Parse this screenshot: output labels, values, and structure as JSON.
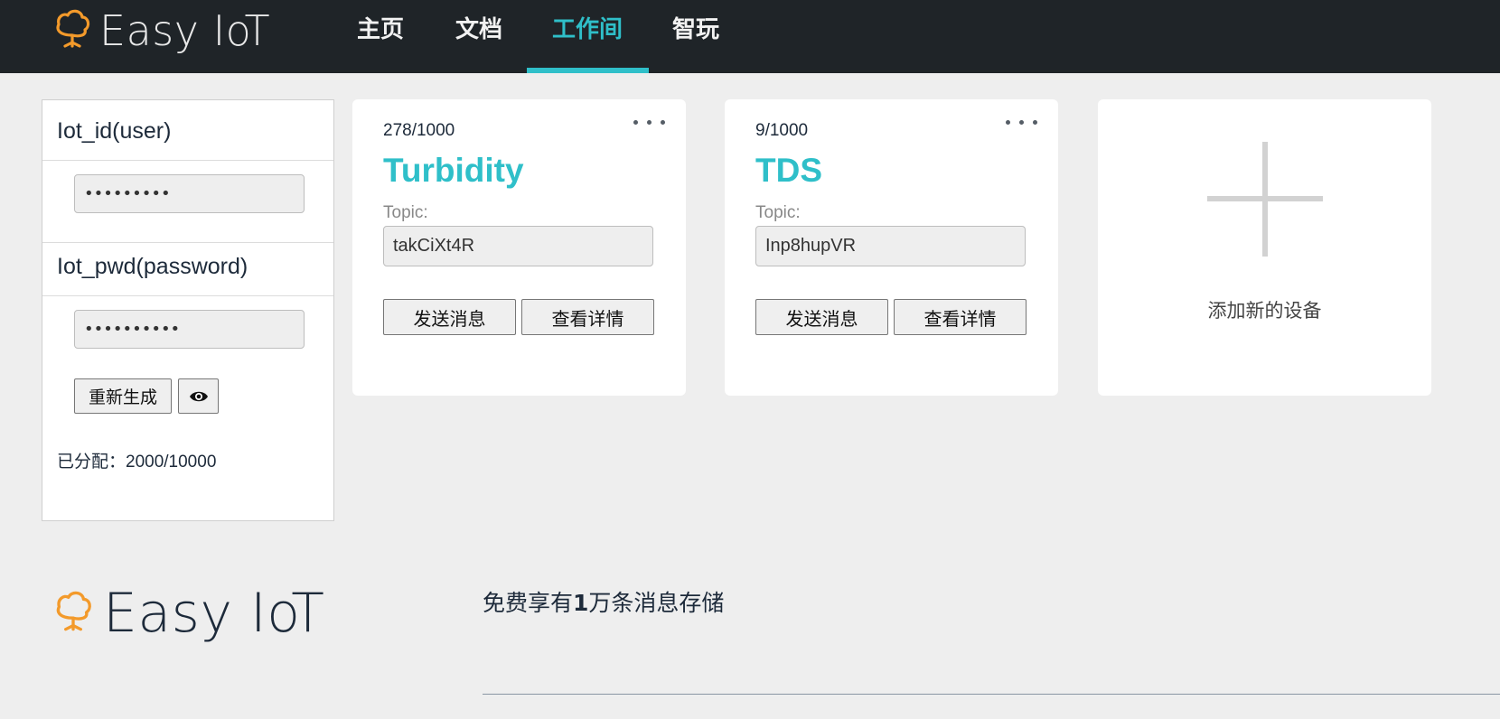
{
  "brand": {
    "name": "Easy IoT",
    "accent": "#f39a2b",
    "nav_bg": "#1f2428",
    "active_color": "#2fbfc9"
  },
  "nav": {
    "items": [
      {
        "label": "主页",
        "active": false
      },
      {
        "label": "文档",
        "active": false
      },
      {
        "label": "工作间",
        "active": true
      },
      {
        "label": "智玩",
        "active": false
      }
    ]
  },
  "credentials": {
    "iot_id_label": "Iot_id(user)",
    "iot_id_value": "•••••••••",
    "iot_pwd_label": "Iot_pwd(password)",
    "iot_pwd_value": "••••••••••",
    "regenerate_label": "重新生成",
    "toggle_icon": "eye-icon",
    "allocated": "已分配：2000/10000"
  },
  "devices": [
    {
      "count": "278/1000",
      "name": "Turbidity",
      "topic_label": "Topic:",
      "topic": "takCiXt4R",
      "send_label": "发送消息",
      "detail_label": "查看详情"
    },
    {
      "count": "9/1000",
      "name": "TDS",
      "topic_label": "Topic:",
      "topic": "Inp8hupVR",
      "send_label": "发送消息",
      "detail_label": "查看详情"
    }
  ],
  "add_device": {
    "label": "添加新的设备",
    "icon": "plus-icon"
  },
  "footer": {
    "text_prefix": "免费享有",
    "text_bold": "1",
    "text_suffix": "万条消息存储"
  }
}
